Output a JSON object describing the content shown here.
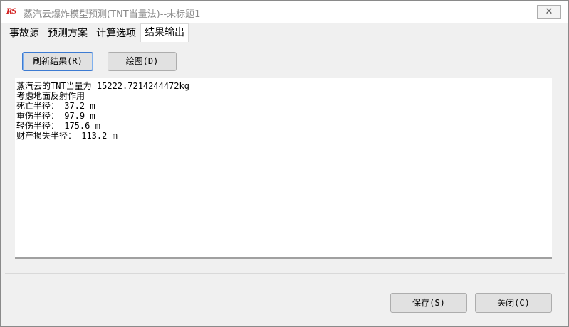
{
  "window": {
    "title": "蒸汽云爆炸模型预测(TNT当量法)--未标题1",
    "icon": "app-logo-icon",
    "icon_text": "RS",
    "close_label": "✕"
  },
  "tabs": [
    {
      "label": "事故源"
    },
    {
      "label": "预测方案"
    },
    {
      "label": "计算选项"
    },
    {
      "label": "结果输出",
      "active": true
    }
  ],
  "toolbar": {
    "refresh_label": "刷新结果(R)",
    "plot_label": "绘图(D)"
  },
  "results": {
    "lines": [
      "蒸汽云的TNT当量为 15222.7214244472kg",
      "考虑地面反射作用",
      "死亡半径： 37.2 m",
      "重伤半径： 97.9 m",
      "轻伤半径： 175.6 m",
      "财产损失半径： 113.2 m"
    ]
  },
  "footer": {
    "save_label": "保存(S)",
    "close_label": "关闭(C)"
  }
}
